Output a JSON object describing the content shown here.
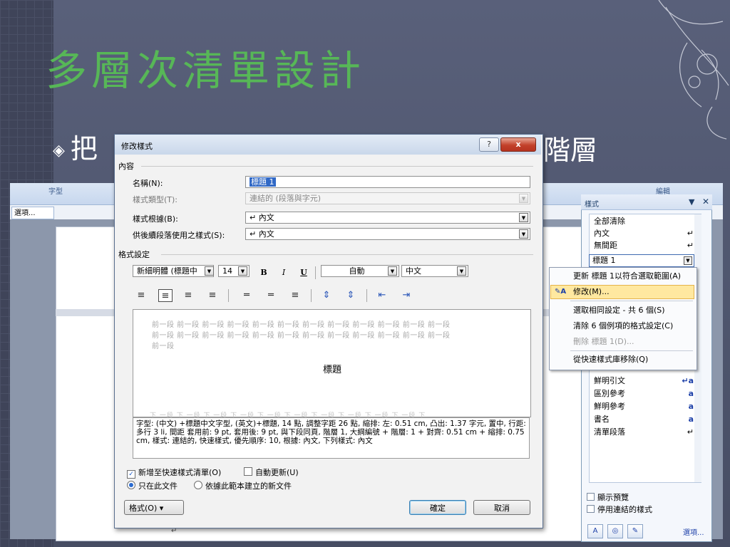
{
  "slide": {
    "title": "多層次清單設計",
    "bullet_mark": "◈",
    "bullet_text_left": "把",
    "bullet_text_right": "階層"
  },
  "ribbon": {
    "font_group": "字型",
    "edit_group": "編輯",
    "options": "選項..."
  },
  "styles_pane": {
    "title": "樣式",
    "items": [
      {
        "label": "全部清除",
        "mark": ""
      },
      {
        "label": "內文",
        "mark": "↵"
      },
      {
        "label": "無間距",
        "mark": "↵"
      },
      {
        "label": "標題 1",
        "mark": ""
      },
      {
        "label": "鮮明引文",
        "mark": "↵a"
      },
      {
        "label": "區別參考",
        "mark": "a"
      },
      {
        "label": "鮮明參考",
        "mark": "a"
      },
      {
        "label": "書名",
        "mark": "a"
      },
      {
        "label": "清單段落",
        "mark": "↵"
      }
    ],
    "show_preview": "顯示預覽",
    "disable_linked": "停用連結的樣式",
    "options": "選項..."
  },
  "context_menu": {
    "items": [
      "更新 標題 1以符合選取範圍(A)",
      "修改(M)...",
      "選取相同設定 - 共 6 個(S)",
      "清除 6 個例項的格式設定(C)",
      "刪除 標題 1(D)...",
      "從快速樣式庫移除(Q)"
    ]
  },
  "dialog": {
    "title": "修改樣式",
    "help": "?",
    "close": "x",
    "section_content": "內容",
    "name_label": "名稱(N):",
    "name_value": "標題 1",
    "type_label": "樣式類型(T):",
    "type_value": "連結的 (段落與字元)",
    "based_label": "樣式根據(B):",
    "based_value": "↵ 內文",
    "next_label": "供後續段落使用之樣式(S):",
    "next_value": "↵ 內文",
    "section_format": "格式設定",
    "font_value": "新細明體 (標題中",
    "size_value": "14",
    "bold": "B",
    "italic": "I",
    "underline": "U",
    "color_value": "自動",
    "lang_value": "中文",
    "preview_prev_1": "前一段 前一段 前一段 前一段 前一段 前一段 前一段 前一段 前一段 前一段 前一段 前一段",
    "preview_prev_2": "前一段 前一段 前一段 前一段 前一段 前一段 前一段 前一段 前一段 前一段 前一段 前一段",
    "preview_prev_3": "前一段",
    "preview_heading": "標題",
    "preview_next": "下 一段 下 一段 下 一段 下 一段 下 一段 下 一段 下 一段 下 一段 下 一段 下 一段 下",
    "description": "字型: (中文) +標題中文字型, (英文)+標題, 14 點, 調整字距 26 點, 縮排: 左: 0.51 cm, 凸出: 1.37 字元, 置中, 行距: 多行 3 li, 間距 套用前: 9 pt, 套用後: 9 pt, 與下段同頁, 階層 1, 大綱編號 + 階層: 1 + 對齊: 0.51 cm + 縮排: 0.75 cm, 樣式: 連結的, 快速樣式, 優先順序: 10, 根據: 內文, 下列樣式: 內文",
    "add_quick": "新增至快速樣式清單(O)",
    "auto_update": "自動更新(U)",
    "only_doc": "只在此文件",
    "new_docs": "依據此範本建立的新文件",
    "format_btn": "格式(O) ▾",
    "ok": "確定",
    "cancel": "取消"
  },
  "doc": {
    "para_mark": "↵"
  },
  "colors": {
    "title_green": "#57b757",
    "accent_blue": "#3169c6"
  }
}
